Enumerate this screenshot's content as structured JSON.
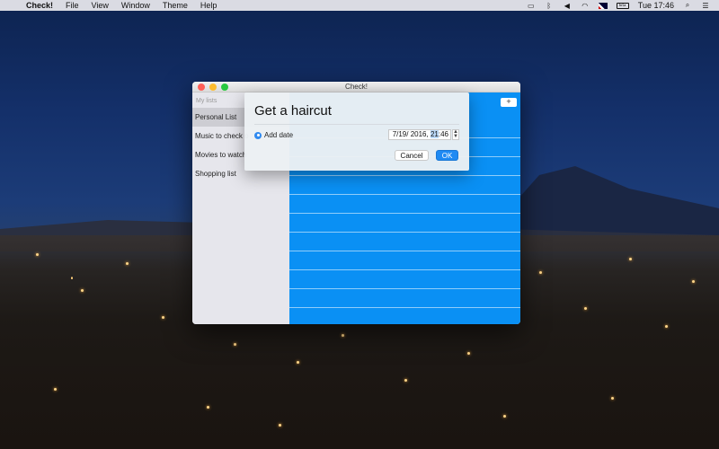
{
  "menubar": {
    "app_name": "Check!",
    "menus": [
      "File",
      "View",
      "Window",
      "Theme",
      "Help"
    ],
    "clock": "Tue 17:46",
    "battery_label": "EG"
  },
  "window": {
    "title": "Check!",
    "add_button": "+"
  },
  "sidebar": {
    "header": "My lists",
    "items": [
      {
        "label": "Personal List",
        "selected": true
      },
      {
        "label": "Music to check o"
      },
      {
        "label": "Movies to watch"
      },
      {
        "label": "Shopping list"
      }
    ]
  },
  "sheet": {
    "title": "Get a haircut",
    "add_date_label": "Add date",
    "date_value_prefix": "7/19/ 2016, ",
    "date_hour": "21",
    "date_separator": ":",
    "date_minute": "46",
    "cancel_label": "Cancel",
    "ok_label": "OK"
  },
  "colors": {
    "accent": "#0a90f4",
    "ok_button": "#1f8af3"
  }
}
